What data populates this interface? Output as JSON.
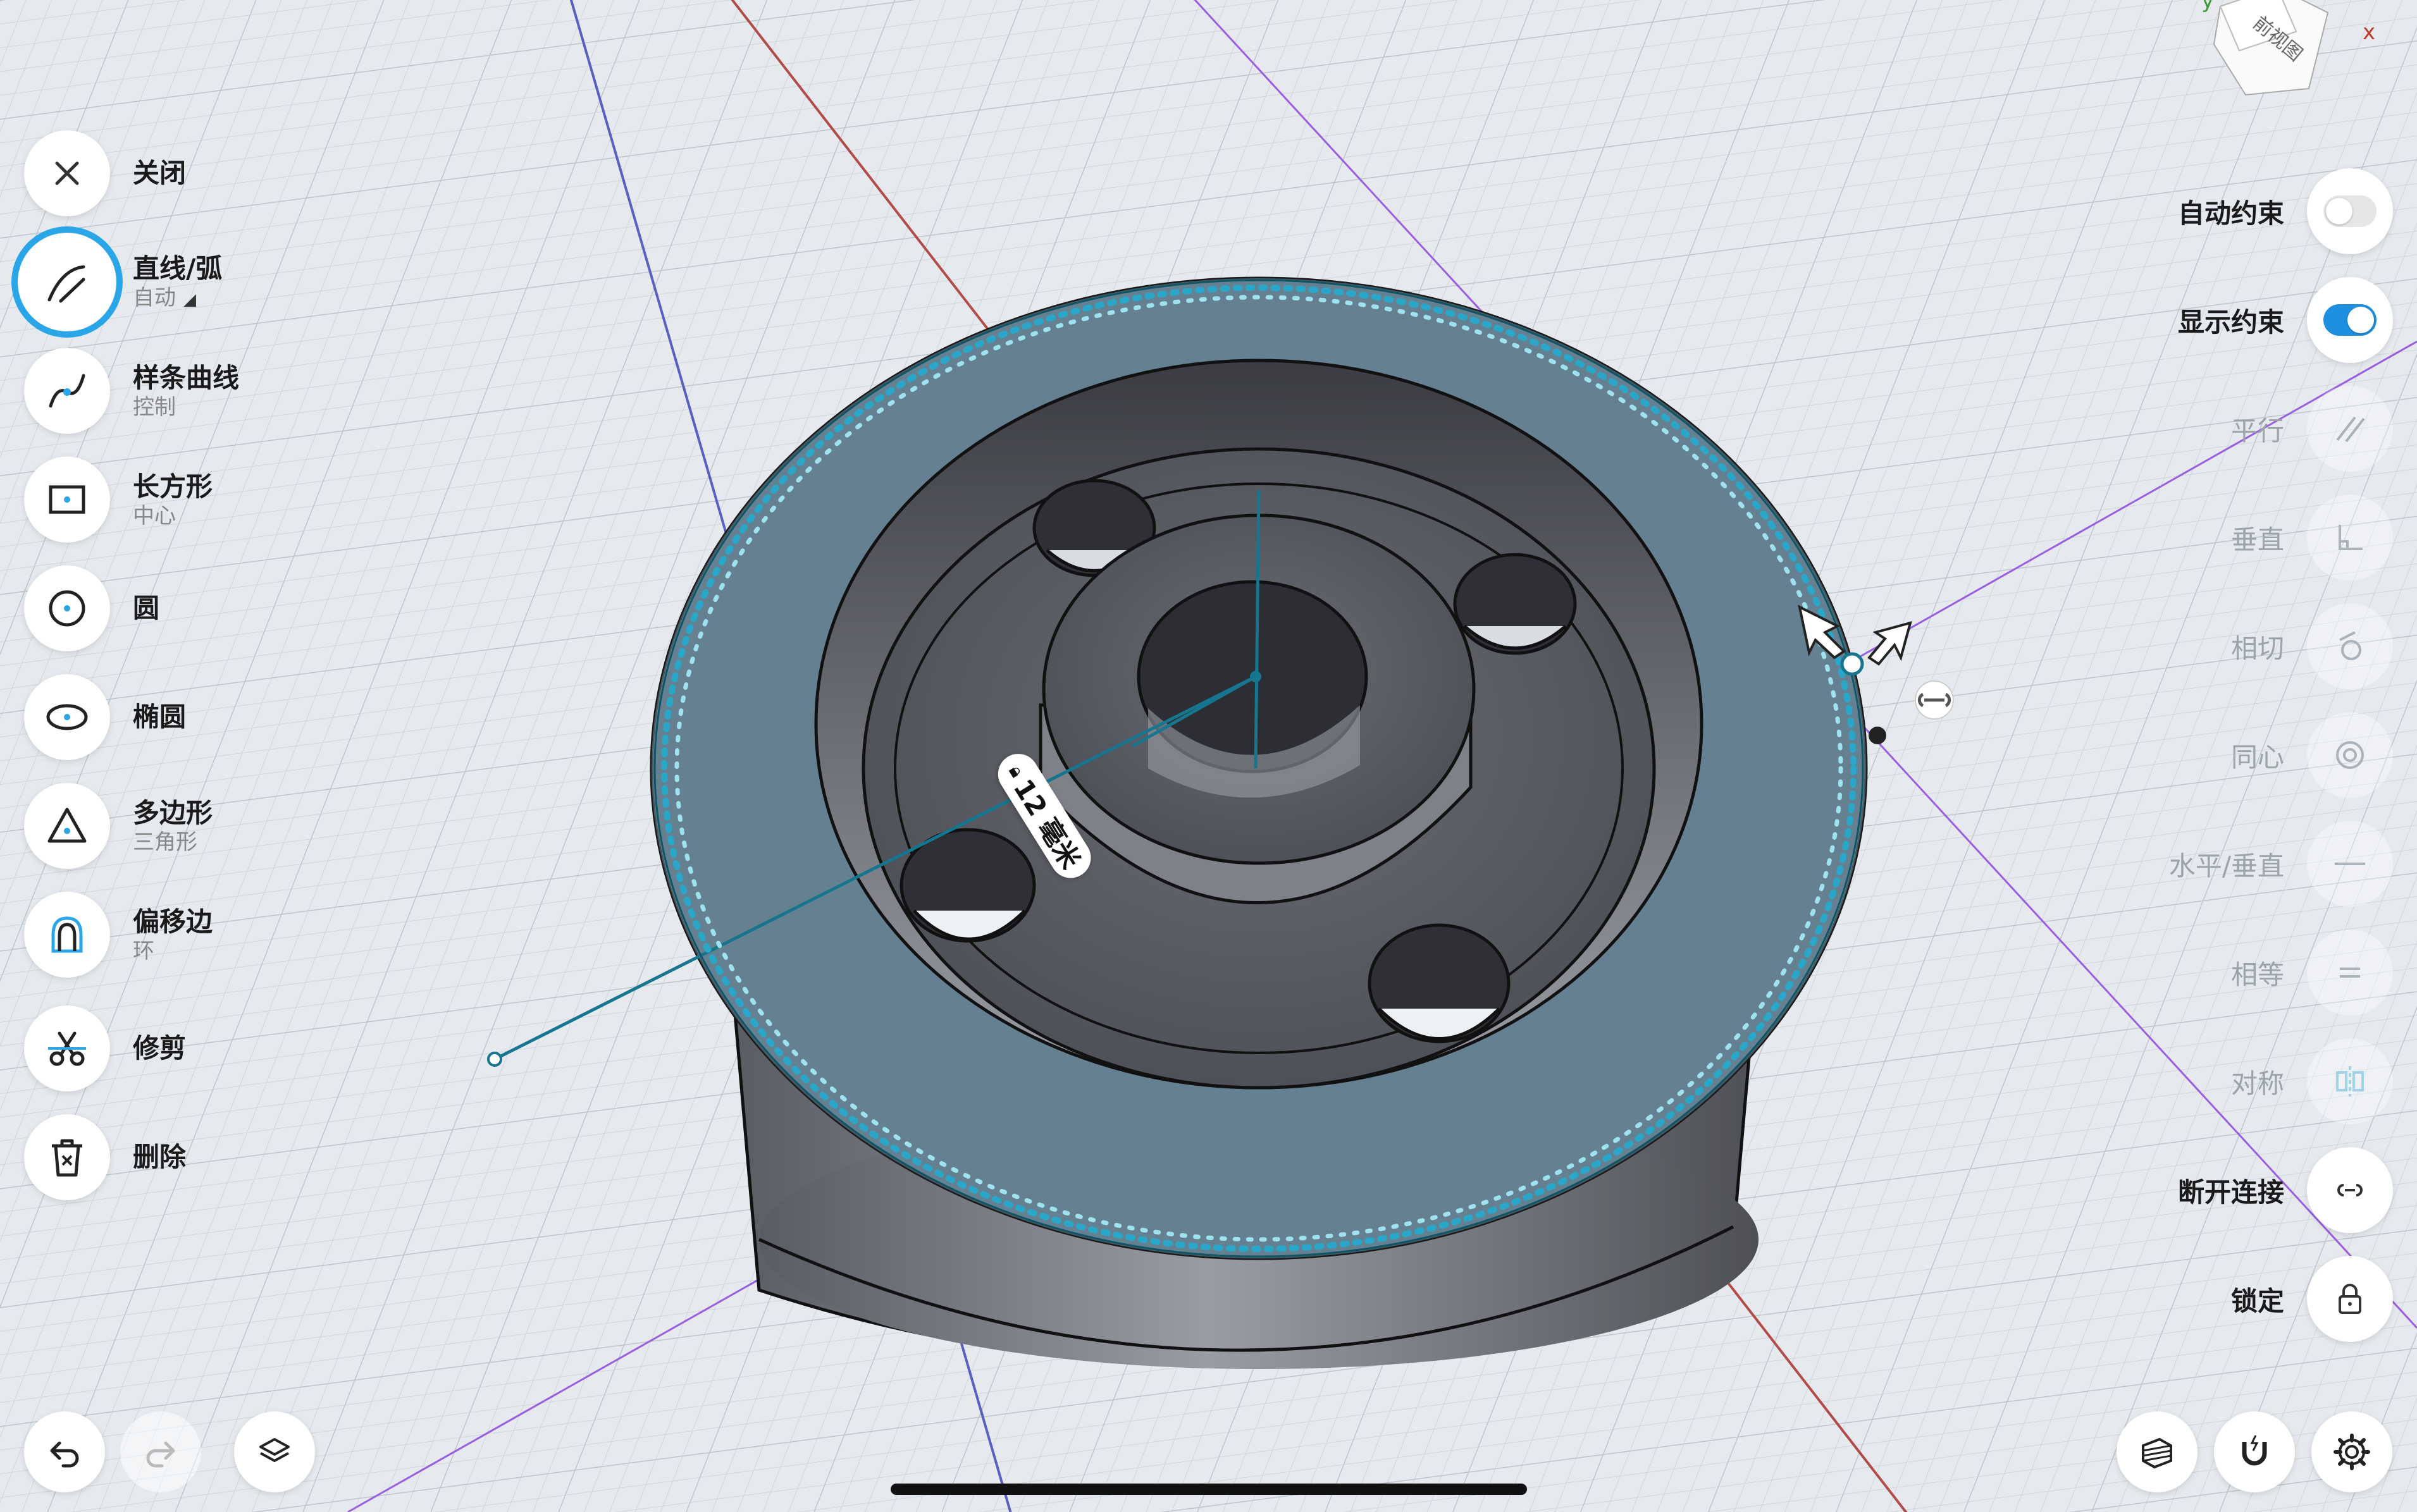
{
  "tools": [
    {
      "name": "close",
      "label": "关闭",
      "sub": "",
      "icon": "close-icon"
    },
    {
      "name": "line-arc",
      "label": "直线/弧",
      "sub": "自动",
      "icon": "line-arc-icon",
      "active": true,
      "dropdown": true
    },
    {
      "name": "spline",
      "label": "样条曲线",
      "sub": "控制",
      "icon": "spline-icon"
    },
    {
      "name": "rectangle",
      "label": "长方形",
      "sub": "中心",
      "icon": "rectangle-icon"
    },
    {
      "name": "circle",
      "label": "圆",
      "sub": "",
      "icon": "circle-icon"
    },
    {
      "name": "ellipse",
      "label": "椭圆",
      "sub": "",
      "icon": "ellipse-icon"
    },
    {
      "name": "polygon",
      "label": "多边形",
      "sub": "三角形",
      "icon": "triangle-icon"
    },
    {
      "name": "offset-edge",
      "label": "偏移边",
      "sub": "环",
      "icon": "offset-icon"
    },
    {
      "name": "trim",
      "label": "修剪",
      "sub": "",
      "icon": "scissors-icon"
    },
    {
      "name": "delete",
      "label": "删除",
      "sub": "",
      "icon": "trash-icon"
    }
  ],
  "constraints": [
    {
      "name": "auto-constraint",
      "label": "自动约束",
      "type": "toggle",
      "on": false
    },
    {
      "name": "show-constraint",
      "label": "显示约束",
      "type": "toggle",
      "on": true
    },
    {
      "name": "parallel",
      "label": "平行",
      "type": "button",
      "enabled": false,
      "icon": "parallel-icon"
    },
    {
      "name": "perpendicular",
      "label": "垂直",
      "type": "button",
      "enabled": false,
      "icon": "perpendicular-icon"
    },
    {
      "name": "tangent",
      "label": "相切",
      "type": "button",
      "enabled": false,
      "icon": "tangent-icon"
    },
    {
      "name": "concentric",
      "label": "同心",
      "type": "button",
      "enabled": false,
      "icon": "concentric-icon"
    },
    {
      "name": "horizontal-vertical",
      "label": "水平/垂直",
      "type": "button",
      "enabled": false,
      "icon": "horizontal-icon"
    },
    {
      "name": "equal",
      "label": "相等",
      "type": "button",
      "enabled": false,
      "icon": "equal-icon"
    },
    {
      "name": "symmetric",
      "label": "对称",
      "type": "button",
      "enabled": false,
      "icon": "symmetry-icon"
    },
    {
      "name": "disconnect",
      "label": "断开连接",
      "type": "button",
      "enabled": true,
      "icon": "unlink-icon"
    },
    {
      "name": "lock",
      "label": "锁定",
      "type": "button",
      "enabled": true,
      "icon": "lock-icon"
    }
  ],
  "dimension": {
    "value": "12 毫米",
    "icon": "lock-icon"
  },
  "viewcube": {
    "face_label": "前视图",
    "axis_x": "x",
    "axis_y": "y"
  },
  "bottom": {
    "undo_icon": "undo-icon",
    "redo_icon": "redo-icon",
    "layers_icon": "layers-icon",
    "render_icon": "render-mode-icon",
    "snap_icon": "magnet-icon",
    "settings_icon": "gear-icon"
  },
  "colors": {
    "accent": "#2aa6e8",
    "toggle_on": "#1f8fe0",
    "sketch": "#17768f",
    "part": "#7d7f87",
    "grid_bg": "#e6eaee"
  }
}
